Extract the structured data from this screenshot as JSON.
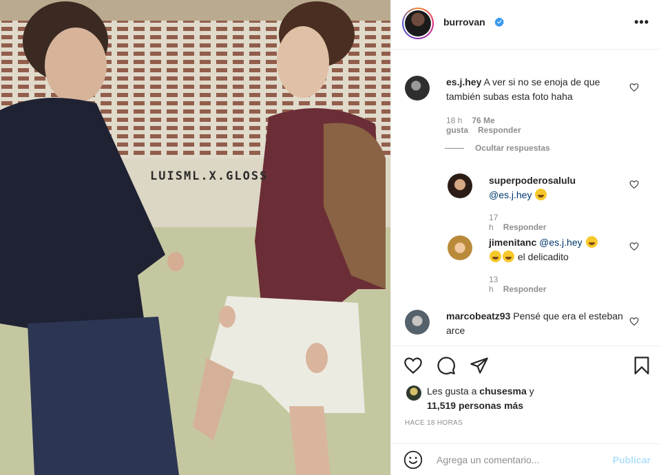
{
  "post": {
    "watermark": "LUISML.X.GLOSS"
  },
  "header": {
    "username": "burrovan",
    "verified": true,
    "more_icon": "more-options-icon"
  },
  "comments": [
    {
      "username": "es.j.hey",
      "text": "A ver si no se enoja de que también subas esta foto haha",
      "time": "18 h",
      "likes": "76 Me gusta",
      "reply": "Responder"
    },
    {
      "username": "marcobeatz93",
      "text": "Pensé que era el esteban arce"
    }
  ],
  "hide_replies": "Ocultar respuestas",
  "replies": [
    {
      "username": "superpoderosalulu",
      "mention": "@es.j.hey",
      "time": "17 h",
      "reply": "Responder"
    },
    {
      "username": "jimenitanc",
      "mention": "@es.j.hey",
      "text": "el delicadito",
      "time": "13 h",
      "reply": "Responder"
    }
  ],
  "likes": {
    "prefix": "Les gusta a",
    "user": "chusesma",
    "joiner": "y",
    "count": "11,519 personas más"
  },
  "timestamp": "HACE 18 HORAS",
  "add_comment": {
    "placeholder": "Agrega un comentario...",
    "publish": "Publicar"
  },
  "colors": {
    "verified": "#3897f0",
    "muted": "#8e8e8e",
    "publish_disabled": "#b2dffc",
    "mention": "#00376b"
  }
}
